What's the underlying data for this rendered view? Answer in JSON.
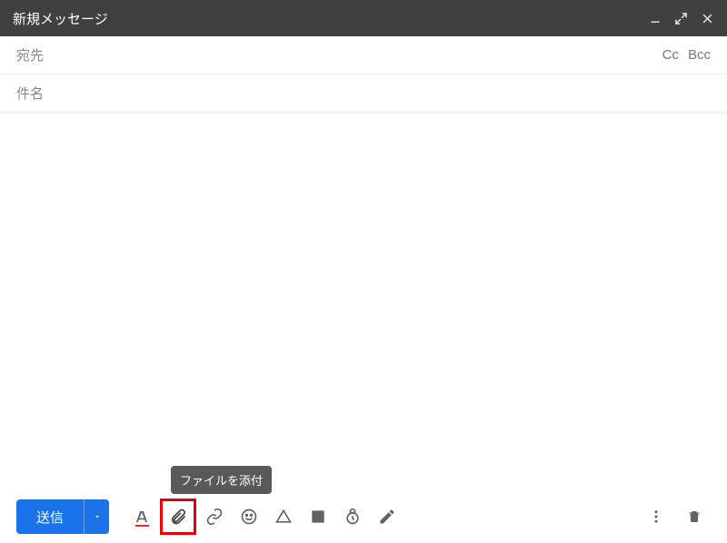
{
  "header": {
    "title": "新規メッセージ"
  },
  "fields": {
    "to_label": "宛先",
    "subject_label": "件名",
    "cc_label": "Cc",
    "bcc_label": "Bcc"
  },
  "toolbar": {
    "send_label": "送信",
    "attach_tooltip": "ファイルを添付"
  },
  "colors": {
    "primary": "#1a73e8",
    "highlight": "#e60000"
  }
}
